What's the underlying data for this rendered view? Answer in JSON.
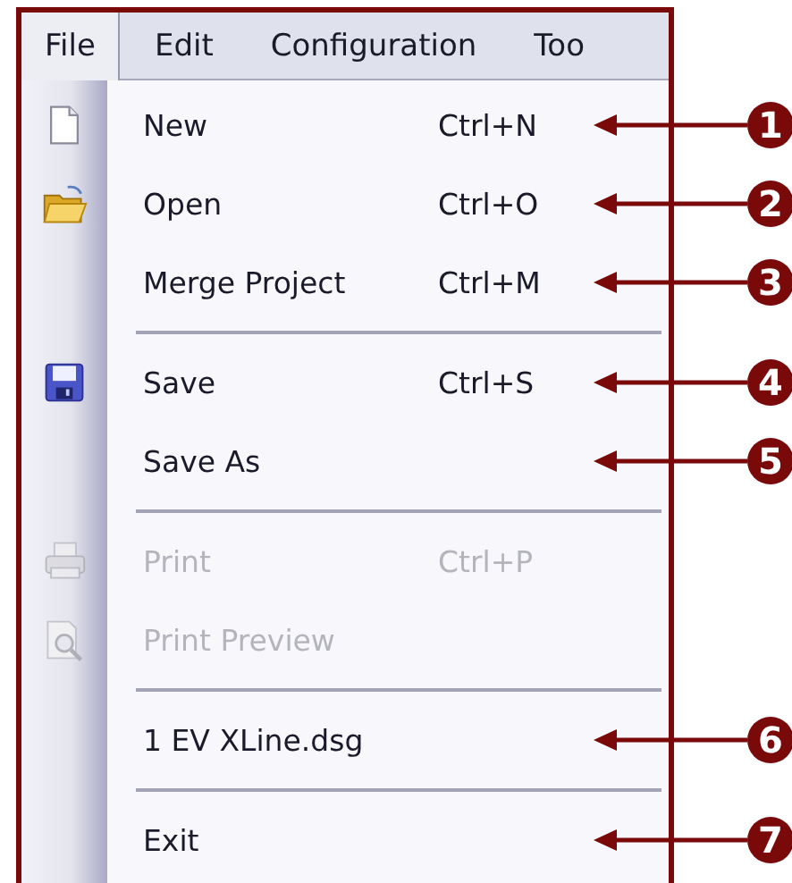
{
  "menubar": [
    {
      "label": "File",
      "selected": true
    },
    {
      "label": "Edit",
      "selected": false
    },
    {
      "label": "Configuration",
      "selected": false
    },
    {
      "label": "Too",
      "selected": false
    }
  ],
  "menu": {
    "items": [
      {
        "kind": "item",
        "label": "New",
        "shortcut": "Ctrl+N",
        "disabled": false,
        "callout": "1"
      },
      {
        "kind": "item",
        "label": "Open",
        "shortcut": "Ctrl+O",
        "disabled": false,
        "callout": "2"
      },
      {
        "kind": "item",
        "label": "Merge Project",
        "shortcut": "Ctrl+M",
        "disabled": false,
        "callout": "3"
      },
      {
        "kind": "separator"
      },
      {
        "kind": "item",
        "label": "Save",
        "shortcut": "Ctrl+S",
        "disabled": false,
        "callout": "4"
      },
      {
        "kind": "item",
        "label": "Save As",
        "disabled": false,
        "callout": "5"
      },
      {
        "kind": "separator"
      },
      {
        "kind": "item",
        "label": "Print",
        "shortcut": "Ctrl+P",
        "disabled": true
      },
      {
        "kind": "item",
        "label": "Print Preview",
        "disabled": true
      },
      {
        "kind": "separator"
      },
      {
        "kind": "item",
        "label": "1 EV XLine.dsg",
        "disabled": false,
        "callout": "6"
      },
      {
        "kind": "separator"
      },
      {
        "kind": "item",
        "label": "Exit",
        "disabled": false,
        "callout": "7"
      }
    ]
  }
}
